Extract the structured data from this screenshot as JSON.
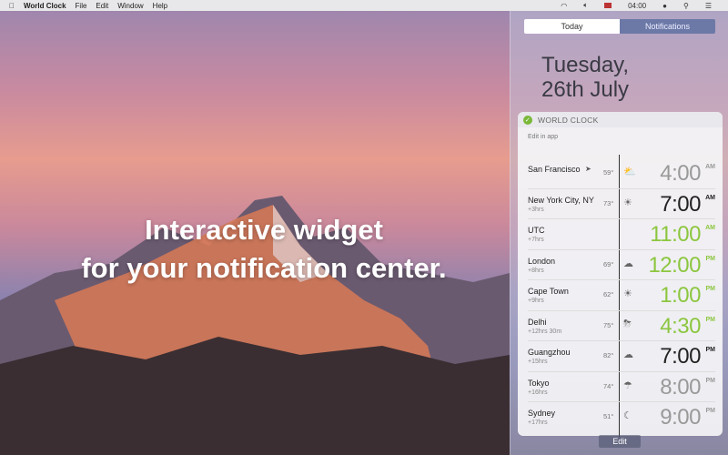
{
  "menubar": {
    "apple": "",
    "app": "World Clock",
    "items": [
      "File",
      "Edit",
      "Window",
      "Help"
    ],
    "clock": "04:00"
  },
  "headline": [
    "Interactive widget",
    "for your notification center."
  ],
  "nc": {
    "tabs": [
      "Today",
      "Notifications"
    ],
    "date": [
      "Tuesday,",
      "26th July"
    ],
    "widget": {
      "title": "WORLD CLOCK",
      "edit_in_app": "Edit in app",
      "rows": [
        {
          "city": "San Francisco",
          "offset": "",
          "temp": "59°",
          "weather": "⛅",
          "time": "4:00",
          "ampm": "AM",
          "color": "gray"
        },
        {
          "city": "New York City, NY",
          "offset": "+3hrs",
          "temp": "73°",
          "weather": "☀",
          "time": "7:00",
          "ampm": "AM",
          "color": "black"
        },
        {
          "city": "UTC",
          "offset": "+7hrs",
          "temp": "",
          "weather": "",
          "time": "11:00",
          "ampm": "AM",
          "color": "green"
        },
        {
          "city": "London",
          "offset": "+8hrs",
          "temp": "69°",
          "weather": "☁",
          "time": "12:00",
          "ampm": "PM",
          "color": "green"
        },
        {
          "city": "Cape Town",
          "offset": "+9hrs",
          "temp": "62°",
          "weather": "☀",
          "time": "1:00",
          "ampm": "PM",
          "color": "green"
        },
        {
          "city": "Delhi",
          "offset": "+12hrs 30m",
          "temp": "75°",
          "weather": "⛈",
          "time": "4:30",
          "ampm": "PM",
          "color": "green"
        },
        {
          "city": "Guangzhou",
          "offset": "+15hrs",
          "temp": "82°",
          "weather": "☁",
          "time": "7:00",
          "ampm": "PM",
          "color": "black"
        },
        {
          "city": "Tokyo",
          "offset": "+16hrs",
          "temp": "74°",
          "weather": "☂",
          "time": "8:00",
          "ampm": "PM",
          "color": "gray"
        },
        {
          "city": "Sydney",
          "offset": "+17hrs",
          "temp": "51°",
          "weather": "☾",
          "time": "9:00",
          "ampm": "PM",
          "color": "gray"
        }
      ]
    },
    "edit": "Edit"
  },
  "colors": {
    "green": "#8cc63f"
  }
}
